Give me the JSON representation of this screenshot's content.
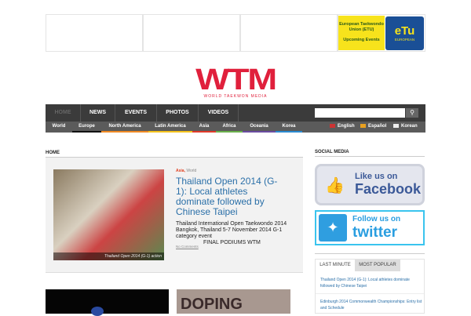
{
  "ad": {
    "etu_text_1": "European Taekwondo Union (ETU)",
    "etu_text_2": "Upcoming Events",
    "etu_logo": "eTu",
    "etu_logo_sub": "EUROPEAN"
  },
  "logo": {
    "main": "WTM",
    "sub": "WORLD TAEKWON MEDIA"
  },
  "nav": {
    "items": [
      "HOME",
      "NEWS",
      "EVENTS",
      "PHOTOS",
      "VIDEOS"
    ],
    "search_placeholder": ""
  },
  "subnav": {
    "items": [
      "World",
      "Europe",
      "North America",
      "Latin America",
      "Asia",
      "Africa",
      "Oceania",
      "Korea"
    ],
    "colors": [
      "#5b5b5b",
      "#111111",
      "#f08a24",
      "#f4c21d",
      "#e03a2a",
      "#6ab04c",
      "#6a4ca0",
      "#2a8ad0"
    ],
    "languages": [
      "English",
      "Español",
      "Korean"
    ]
  },
  "main": {
    "heading": "HOME",
    "feature": {
      "cat1": "Asia,",
      "cat2": "World",
      "title": "Thailand Open 2014 (G-1): Local athletes dominate followed by Chinese Taipei",
      "excerpt": "Thailand International Open Taekwondo 2014 Bangkok, Thailand 5-7 November 2014 G-1 category event",
      "excerpt2": "FINAL PODIUMS WTM",
      "comments": "No Comments",
      "caption": "Thailand Open 2014 (G-1) action"
    },
    "thumb2_text": "DOPING"
  },
  "sidebar": {
    "heading": "SOCIAL MEDIA",
    "facebook_1": "Like us on",
    "facebook_2": "Facebook",
    "twitter_1": "Follow us on",
    "twitter_2": "twitter",
    "tabs": [
      "LAST MINUTE",
      "MOST POPULAR"
    ],
    "items": [
      "Thailand Open 2014 (G-1): Local athletes dominate followed by Chinese Taipei",
      "Edinburgh 2014 Commonwealth Championships: Entry list and Schedule"
    ]
  }
}
